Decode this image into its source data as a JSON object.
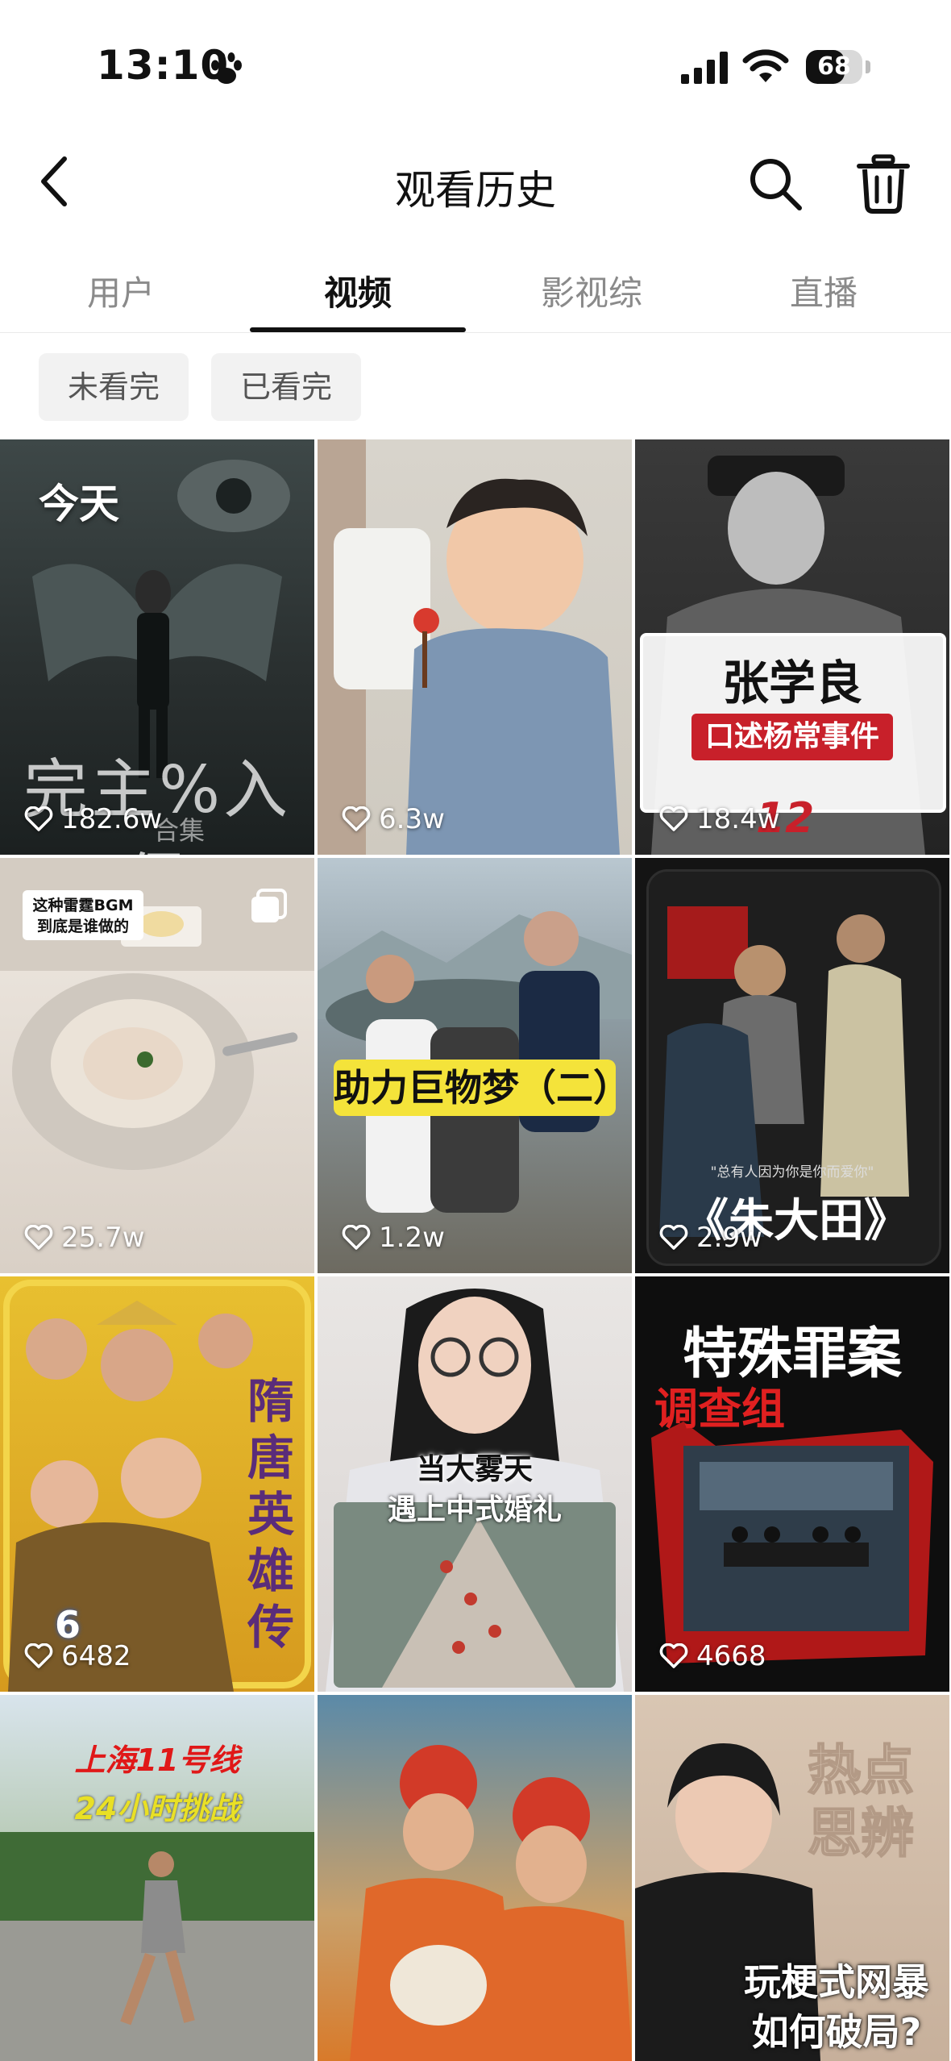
{
  "status_bar": {
    "time": "13:10",
    "battery": "68",
    "battery_level": 0.68
  },
  "nav": {
    "title": "观看历史"
  },
  "tabs": [
    {
      "label": "用户"
    },
    {
      "label": "视频"
    },
    {
      "label": "影视综"
    },
    {
      "label": "直播"
    }
  ],
  "active_tab": "视频",
  "filters": [
    {
      "label": "未看完"
    },
    {
      "label": "已看完"
    }
  ],
  "section_label": "今天",
  "videos": [
    {
      "likes": "182.6w",
      "overlay": [
        "完主%入侵",
        "合集"
      ]
    },
    {
      "likes": "6.3w"
    },
    {
      "likes": "18.4w",
      "overlay": [
        "张学良",
        "口述杨常事件",
        "12"
      ]
    },
    {
      "likes": "25.7w",
      "overlay": [
        "这种雷霆BGM",
        "到底是谁做的"
      ],
      "multi_image": true
    },
    {
      "likes": "1.2w",
      "overlay": [
        "助力巨物梦（二）"
      ]
    },
    {
      "likes": "2.9w",
      "overlay": [
        "《朱大田》",
        "\"总有人因为你是你而爱你\""
      ]
    },
    {
      "likes": "6482",
      "overlay": [
        "隋唐英雄传",
        "6"
      ]
    },
    {
      "likes": "",
      "overlay": [
        "当大雾天",
        "遇上中式婚礼"
      ]
    },
    {
      "likes": "4668",
      "overlay": [
        "特殊罪案",
        "调查组"
      ]
    },
    {
      "likes": "",
      "overlay": [
        "上海11号线",
        "24小时挑战"
      ]
    },
    {
      "likes": "",
      "overlay": []
    },
    {
      "likes": "",
      "overlay": [
        "热点",
        "思辨",
        "玩梗式网暴",
        "如何破局?"
      ]
    }
  ]
}
